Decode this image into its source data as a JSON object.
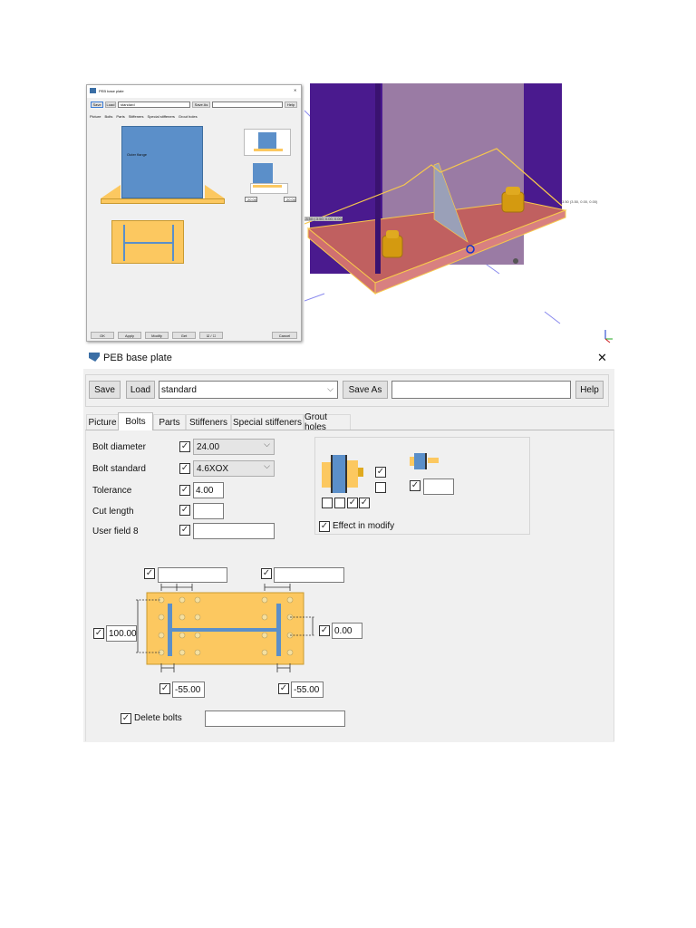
{
  "dialog": {
    "title": "PEB base plate",
    "toolbar": {
      "save": "Save",
      "load": "Load",
      "preset": "standard",
      "save_as": "Save As",
      "save_as_name": "",
      "help": "Help"
    },
    "tabs": [
      "Picture",
      "Bolts",
      "Parts",
      "Stiffeners",
      "Special stiffeners",
      "Grout holes"
    ],
    "active_tab": "Bolts",
    "fields": [
      {
        "label": "Bolt diameter",
        "value": "24.00",
        "checked": true
      },
      {
        "label": "Bolt standard",
        "value": "4.6XOX",
        "checked": true
      },
      {
        "label": "Tolerance",
        "value": "4.00",
        "checked": true
      },
      {
        "label": "Cut length",
        "value": "",
        "checked": true
      },
      {
        "label": "User field 8",
        "value": "",
        "checked": true
      }
    ],
    "effect_in_modify": "Effect in modify",
    "plate": {
      "top_left_value": "",
      "top_right_value": "",
      "left_value": "100.00",
      "right_value": "0.00",
      "bottom_left_value": "-55.00",
      "bottom_right_value": "-55.00",
      "delete_bolts_label": "Delete bolts",
      "delete_bolts_value": ""
    },
    "close": "✕"
  },
  "small_dialog": {
    "title": "PEB base plate",
    "save": "Save",
    "load": "Load",
    "preset": "standard",
    "save_as": "Save As",
    "help": "Help",
    "tabs": [
      "Picture",
      "Bolts",
      "Parts",
      "Stiffeners",
      "Special stiffeners",
      "Grout holes"
    ],
    "flange_label": "Outer flange",
    "dim_left": "20.00",
    "dim_right": "20.00",
    "buttons": [
      "OK",
      "Apply",
      "Modify",
      "Get",
      "☑ / ☐",
      "Cancel"
    ]
  },
  "model_view": {
    "coord_right": "3.50 (3.50, 0.00, 0.00)",
    "coord_left": "-3.50 (-3.50, 0.00, 0.00)"
  },
  "colors": {
    "plate": "#fcc860",
    "profile": "#5b8fc9",
    "column": "#4a1a8e",
    "baseplate": "#c06060"
  }
}
